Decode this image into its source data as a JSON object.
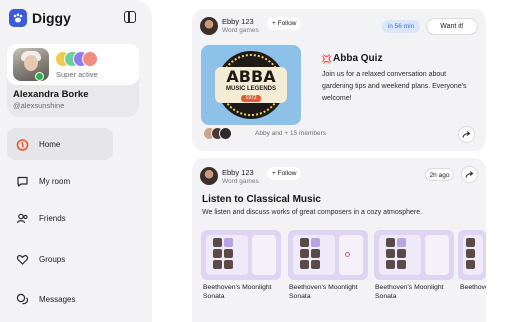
{
  "app": {
    "name": "Diggy"
  },
  "profile": {
    "status": "Super active",
    "name": "Alexandra Borke",
    "handle": "@alexsunshine"
  },
  "nav": [
    {
      "label": "Home",
      "icon": "flame-icon",
      "active": true
    },
    {
      "label": "My room",
      "icon": "chat-bubble-icon"
    },
    {
      "label": "Friends",
      "icon": "people-icon"
    },
    {
      "label": "Groups",
      "icon": "heart-icon"
    },
    {
      "label": "Messages",
      "icon": "messages-icon"
    }
  ],
  "feed": {
    "card1": {
      "host_name": "Ebby 123",
      "host_sub": "Word games",
      "follow_label": "+ Follow",
      "time": "in 56 min",
      "want_label": "Want it!",
      "image_text": {
        "line1": "ABBA",
        "line2": "MUSIC LEGENDS",
        "line3": "1972"
      },
      "title": "Abba Quiz",
      "emoji": "💢",
      "description": "Join us for a relaxed conversation about gardening tips and weekend plans. Everyone's welcome!",
      "members_text": "Abby and + 15 members"
    },
    "card2": {
      "host_name": "Ebby 123",
      "host_sub": "Word games",
      "follow_label": "+ Follow",
      "time": "2h ago",
      "title": "Listen to Classical Music",
      "description": "We listen and discuss works of great composers in a cozy atmosphere.",
      "games": [
        {
          "label": "Beethoven's Moonlight Sonata"
        },
        {
          "label": "Beethoven's Moonlight Sonata"
        },
        {
          "label": "Beethoven's Moonlight Sonata"
        },
        {
          "label": "Beethoven's Moonlight Sonata"
        }
      ]
    }
  },
  "colors": {
    "accent": "#3b5bdb",
    "online": "#29b34b",
    "time_pill_bg": "#dbe6fb",
    "time_pill_text": "#3b6fd8"
  }
}
